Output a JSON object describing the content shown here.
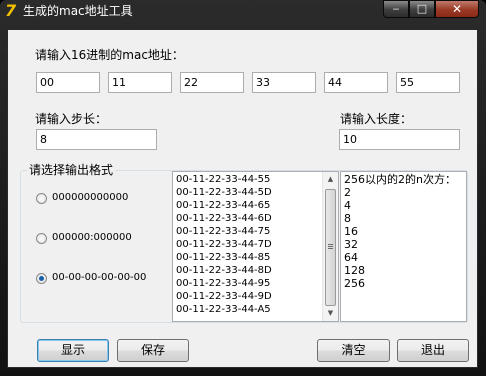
{
  "window": {
    "title": "生成的mac地址工具",
    "minimize": "‒",
    "maximize": "□",
    "close": "✕"
  },
  "mac": {
    "label": "请输入16进制的mac地址：",
    "octets": [
      "00",
      "11",
      "22",
      "33",
      "44",
      "55"
    ]
  },
  "step": {
    "label": "请输入步长：",
    "value": "8"
  },
  "length": {
    "label": "请输入长度：",
    "value": "10"
  },
  "format": {
    "label": "请选择输出格式",
    "options": [
      "000000000000",
      "000000:000000",
      "00-00-00-00-00-00"
    ],
    "selected_index": 2
  },
  "output_list": [
    "00-11-22-33-44-55",
    "00-11-22-33-44-5D",
    "00-11-22-33-44-65",
    "00-11-22-33-44-6D",
    "00-11-22-33-44-75",
    "00-11-22-33-44-7D",
    "00-11-22-33-44-85",
    "00-11-22-33-44-8D",
    "00-11-22-33-44-95",
    "00-11-22-33-44-9D",
    "00-11-22-33-44-A5"
  ],
  "powers": {
    "header": "256以内的2的n次方：",
    "items": [
      "2",
      "4",
      "8",
      "16",
      "32",
      "64",
      "128",
      "256"
    ]
  },
  "buttons": {
    "show": "显示",
    "save": "保存",
    "clear": "清空",
    "exit": "退出"
  },
  "colors": {
    "close_button": "#9a3a26",
    "default_button_border": "#3c7fb1"
  }
}
